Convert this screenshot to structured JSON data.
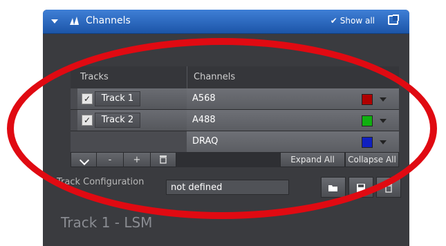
{
  "header": {
    "title": "Channels",
    "show_all_label": "Show all"
  },
  "grid": {
    "col_tracks": "Tracks",
    "col_channels": "Channels",
    "tracks": [
      {
        "label": "Track 1",
        "checked": true
      },
      {
        "label": "Track 2",
        "checked": true
      }
    ],
    "channels": [
      {
        "label": "A568",
        "color": "#b00000"
      },
      {
        "label": "A488",
        "color": "#10b010"
      },
      {
        "label": "DRAQ",
        "color": "#1020c0"
      }
    ]
  },
  "toolbar": {
    "minus": "-",
    "plus": "+",
    "expand_all": "Expand All",
    "collapse_all": "Collapse All"
  },
  "config": {
    "label": "Track Configuration",
    "value": "not defined"
  },
  "footer": {
    "label": "Track 1 - LSM"
  },
  "icons": {
    "open": "folder-open-icon",
    "save": "save-icon",
    "delete": "trash-icon"
  },
  "colors": {
    "accent": "#1c55a8",
    "annotation": "#e00a12"
  }
}
